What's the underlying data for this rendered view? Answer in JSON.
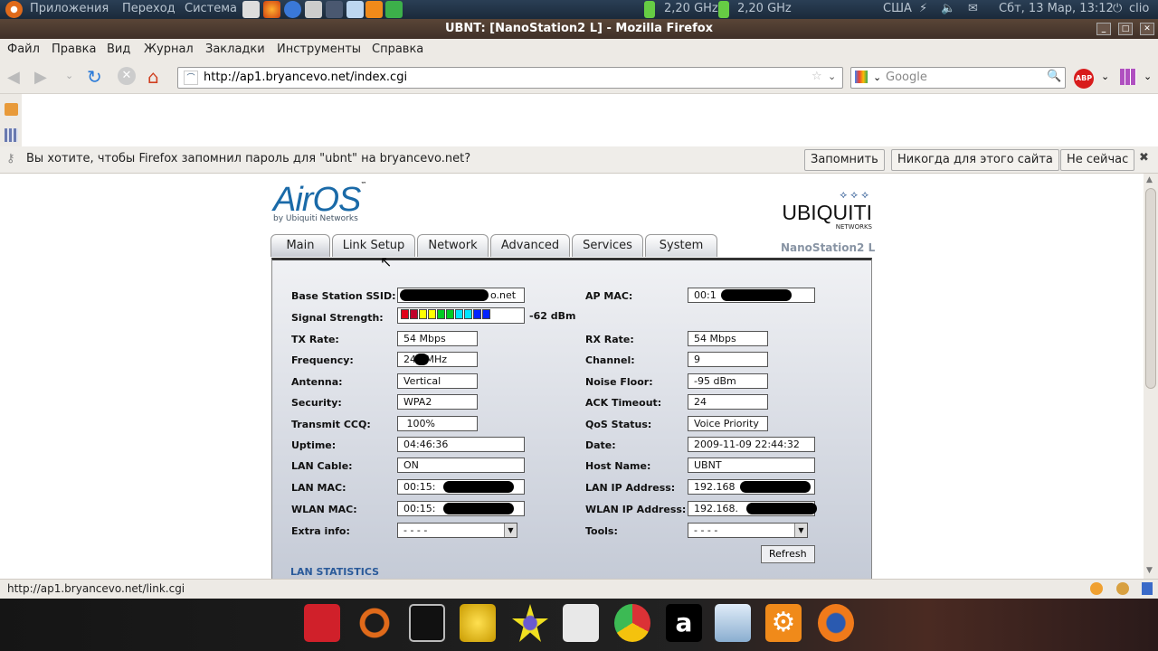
{
  "top_panel": {
    "menus": [
      "Приложения",
      "Переход",
      "Система"
    ],
    "cpu1": "2,20 GHz",
    "cpu2": "2,20 GHz",
    "keyboard": "США",
    "datetime": "Сбт, 13 Мар, 13:12",
    "user": "clio"
  },
  "window": {
    "title": "UBNT: [NanoStation2 L] - Mozilla Firefox"
  },
  "menu": [
    "Файл",
    "Правка",
    "Вид",
    "Журнал",
    "Закладки",
    "Инструменты",
    "Справка"
  ],
  "nav": {
    "url": "http://ap1.bryancevo.net/index.cgi",
    "search_placeholder": "Google"
  },
  "notification": {
    "text": "Вы хотите, чтобы Firefox запомнил пароль для \"ubnt\" на bryancevo.net?",
    "buttons": [
      "Запомнить",
      "Никогда для этого сайта",
      "Не сейчас"
    ]
  },
  "page": {
    "logo_airos": "AirOS",
    "logo_airos_sub": "by Ubiquiti Networks",
    "logo_ubnt": "UBIQUITI",
    "logo_ubnt_sub": "NETWORKS",
    "device": "NanoStation2 L",
    "tabs": [
      "Main",
      "Link Setup",
      "Network",
      "Advanced",
      "Services",
      "System"
    ],
    "active_tab": "Main",
    "signal": {
      "value": "-62 dBm",
      "bars": 10,
      "colors": [
        "#e0001a",
        "#c0002a",
        "#ffff00",
        "#ffff00",
        "#00cc22",
        "#00cc22",
        "#00e5ff",
        "#00e5ff",
        "#0022ff",
        "#0022ff"
      ]
    },
    "left": [
      {
        "label": "Base Station SSID:",
        "value": "o.net",
        "wide": true,
        "redacted": true
      },
      {
        "label": "Signal Strength:"
      },
      {
        "label": "TX Rate:",
        "value": "54 Mbps"
      },
      {
        "label": "Frequency:",
        "value": "24   MHz",
        "redacted": true
      },
      {
        "label": "Antenna:",
        "value": "Vertical"
      },
      {
        "label": "Security:",
        "value": "WPA2"
      },
      {
        "label": "Transmit CCQ:",
        "value": " 100%"
      },
      {
        "label": "Uptime:",
        "value": "04:46:36",
        "wide": true
      },
      {
        "label": "LAN Cable:",
        "value": "ON",
        "wide": true
      },
      {
        "label": "LAN MAC:",
        "value": "00:15:",
        "wide": true,
        "redacted": true
      },
      {
        "label": "WLAN MAC:",
        "value": "00:15:",
        "wide": true,
        "redacted": true
      },
      {
        "label": "Extra info:",
        "value": "- - - -",
        "select": true
      }
    ],
    "right": [
      {
        "label": "AP MAC:",
        "value": "00:1",
        "wide": true,
        "redacted": true
      },
      null,
      {
        "label": "RX Rate:",
        "value": "54 Mbps"
      },
      {
        "label": "Channel:",
        "value": "9"
      },
      {
        "label": "Noise Floor:",
        "value": "-95 dBm"
      },
      {
        "label": "ACK Timeout:",
        "value": "24"
      },
      {
        "label": "QoS Status:",
        "value": "Voice Priority"
      },
      {
        "label": "Date:",
        "value": "2009-11-09 22:44:32",
        "wide": true
      },
      {
        "label": "Host Name:",
        "value": "UBNT",
        "wide": true
      },
      {
        "label": "LAN IP Address:",
        "value": "192.168",
        "wide": true,
        "redacted": true
      },
      {
        "label": "WLAN IP Address:",
        "value": "192.168.",
        "wide": true,
        "redacted": true
      },
      {
        "label": "Tools:",
        "value": "- - - -",
        "select": true
      }
    ],
    "refresh": "Refresh",
    "lan_stats": "LAN STATISTICS"
  },
  "status_bar": {
    "text": "http://ap1.bryancevo.net/link.cgi"
  }
}
